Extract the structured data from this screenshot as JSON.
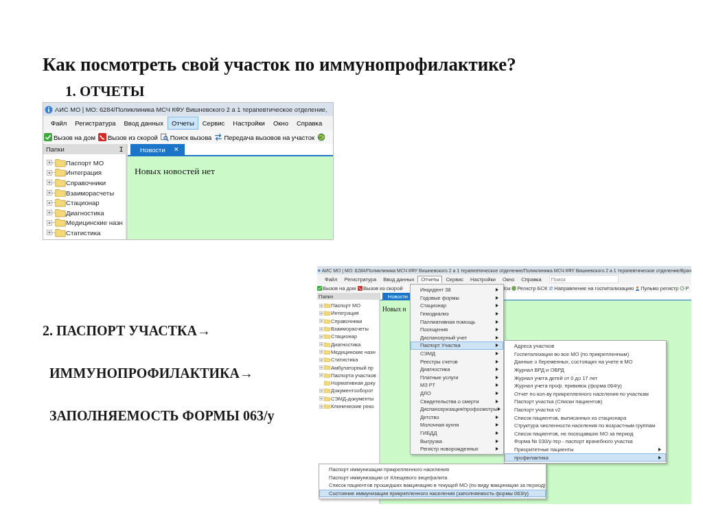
{
  "slide": {
    "title": "Как посмотреть свой участок по иммунопрофилактике?",
    "step_1": "1. ОТЧЕТЫ",
    "step_2_lines": [
      "2.  ПАСПОРТ УЧАСТКА→",
      "ИММУНОПРОФИЛАКТИКА→",
      "ЗАПОЛНЯЕМОСТЬ ФОРМЫ 063/у"
    ]
  },
  "screenshot_1": {
    "window_title": "АИС МО | МО: 6284/Поликлиника МСЧ КФУ Вишневского 2 а 1 терапевтическое отделение,",
    "menu": [
      {
        "label": "Файл",
        "selected": false
      },
      {
        "label": "Регистратура",
        "selected": false
      },
      {
        "label": "Ввод данных",
        "selected": false
      },
      {
        "label": "Отчеты",
        "selected": true
      },
      {
        "label": "Сервис",
        "selected": false
      },
      {
        "label": "Настройки",
        "selected": false
      },
      {
        "label": "Окно",
        "selected": false
      },
      {
        "label": "Справка",
        "selected": false
      }
    ],
    "toolbar": [
      {
        "kind": "check",
        "label": "Вызов на дом"
      },
      {
        "kind": "red",
        "label": "Вызов из скорой"
      },
      {
        "kind": "search",
        "label": "Поиск вызова"
      },
      {
        "kind": "transfer",
        "label": "Передача вызовов на участок"
      },
      {
        "kind": "globe"
      }
    ],
    "panel_title": "Папки",
    "pin": "ⵊ",
    "tree": [
      {
        "label": "Паспорт МО",
        "expandable": true
      },
      {
        "label": "Интеграция",
        "expandable": true
      },
      {
        "label": "Справочники",
        "expandable": true
      },
      {
        "label": "Взаиморасчеты",
        "expandable": true
      },
      {
        "label": "Стационар",
        "expandable": true
      },
      {
        "label": "Диагностика",
        "expandable": true
      },
      {
        "label": "Медицинские назн",
        "expandable": true
      },
      {
        "label": "Статистика",
        "expandable": true
      }
    ],
    "tab": {
      "label": "Новости",
      "close": "✕"
    },
    "content": "Новых новостей нет"
  },
  "screenshot_2": {
    "window_title": "АИС МО | МО: 6284/Поликлиника МСЧ КФУ Вишневского 2 а 1 терапевтическое отделение/Поликлиника МСЧ КФУ Вишневского 2 а 1 терапевтическое отделение/Врач",
    "menu": [
      {
        "label": "Файл",
        "selected": false
      },
      {
        "label": "Регистратура",
        "selected": false
      },
      {
        "label": "Ввод данных",
        "selected": false
      },
      {
        "label": "Отчеты",
        "selected": true
      },
      {
        "label": "Сервис",
        "selected": false
      },
      {
        "label": "Настройки",
        "selected": false
      },
      {
        "label": "Окно",
        "selected": false
      },
      {
        "label": "Справка",
        "selected": false
      }
    ],
    "search": {
      "placeholder": "Поиск"
    },
    "toolbar_left": [
      {
        "kind": "check",
        "label": "Вызов на дом"
      },
      {
        "kind": "red",
        "label": "Вызов из скорой"
      }
    ],
    "toolbar_right": [
      {
        "kind": "none",
        "label": "ток"
      },
      {
        "kind": "globe",
        "label": "Регистр БСК"
      },
      {
        "kind": "transfer",
        "label": "Направление на госпитализацию"
      },
      {
        "kind": "person",
        "label": "Пульмо регистр"
      },
      {
        "kind": "gear",
        "label": "Р"
      }
    ],
    "panel_title": "Папки",
    "tab": {
      "label": "Новости"
    },
    "content": "Новых н",
    "tree": [
      {
        "label": "Паспорт МО",
        "expandable": true
      },
      {
        "label": "Интеграция",
        "expandable": true
      },
      {
        "label": "Справочники",
        "expandable": true
      },
      {
        "label": "Взаиморасчеты",
        "expandable": true
      },
      {
        "label": "Стационар",
        "expandable": true
      },
      {
        "label": "Диагностика",
        "expandable": true
      },
      {
        "label": "Медицинские назн",
        "expandable": true
      },
      {
        "label": "Статистика",
        "expandable": true
      },
      {
        "label": "Амбулаторный пр",
        "expandable": true
      },
      {
        "label": "Паспорта участков",
        "expandable": true
      },
      {
        "label": "Нормативная доку",
        "expandable": false
      },
      {
        "label": "Документооборот",
        "expandable": true
      },
      {
        "label": "СЭМД-документы",
        "expandable": true
      },
      {
        "label": "Клинические реко",
        "expandable": true
      }
    ],
    "reports_menu": [
      {
        "label": "Инцидент 38",
        "selected": false,
        "has_submenu": true
      },
      {
        "label": "Годовые формы",
        "selected": false,
        "has_submenu": true
      },
      {
        "label": "Стационар",
        "selected": false,
        "has_submenu": true
      },
      {
        "label": "Гемодиализ",
        "selected": false,
        "has_submenu": true
      },
      {
        "label": "Паллиативная помощь",
        "selected": false,
        "has_submenu": true
      },
      {
        "label": "Посещения",
        "selected": false,
        "has_submenu": true
      },
      {
        "label": "Диспансерный учет",
        "selected": false,
        "has_submenu": true
      },
      {
        "label": "Паспорт Участка",
        "selected": true,
        "has_submenu": true
      },
      {
        "label": "СЭМД",
        "selected": false,
        "has_submenu": true
      },
      {
        "label": "Реестры счетов",
        "selected": false,
        "has_submenu": true
      },
      {
        "label": "Диагностика",
        "selected": false,
        "has_submenu": true
      },
      {
        "label": "Платные услуги",
        "selected": false,
        "has_submenu": true
      },
      {
        "label": "МЗ РТ",
        "selected": false,
        "has_submenu": true
      },
      {
        "label": "ДЛО",
        "selected": false,
        "has_submenu": true
      },
      {
        "label": "Свидетельства о смерти",
        "selected": false,
        "has_submenu": true
      },
      {
        "label": "Диспансеризация/профосмотры",
        "selected": false,
        "has_submenu": true
      },
      {
        "label": "Детство",
        "selected": false,
        "has_submenu": true
      },
      {
        "label": "Молочная кухня",
        "selected": false,
        "has_submenu": true
      },
      {
        "label": "ГИБДД",
        "selected": false,
        "has_submenu": true
      },
      {
        "label": "Выгрузка",
        "selected": false,
        "has_submenu": true
      },
      {
        "label": "Регистр новорожденных",
        "selected": false,
        "has_submenu": true
      }
    ],
    "district_menu": [
      {
        "label": "Адреса участков",
        "selected": false,
        "has_submenu": false
      },
      {
        "label": "Госпитализации во все МО (по прикрепленным)",
        "selected": false,
        "has_submenu": false
      },
      {
        "label": "Данные о беременных, состоящих на учете в МО",
        "selected": false,
        "has_submenu": false
      },
      {
        "label": "Журнал ВРД и ОВРД",
        "selected": false,
        "has_submenu": false
      },
      {
        "label": "Журнал учета детей от 0 до 17 лет",
        "selected": false,
        "has_submenu": false
      },
      {
        "label": "Журнал учета проф. прививок (форма 064/у)",
        "selected": false,
        "has_submenu": false
      },
      {
        "label": "Отчет по кол-ву прикрепленного населения по участкам",
        "selected": false,
        "has_submenu": false
      },
      {
        "label": "Паспорт участка (Списки пациентов)",
        "selected": false,
        "has_submenu": false
      },
      {
        "label": "Паспорт участка v2",
        "selected": false,
        "has_submenu": false
      },
      {
        "label": "Список пациентов, выписанных из стационара",
        "selected": false,
        "has_submenu": false
      },
      {
        "label": "Структура численности населения по возрастным группам",
        "selected": false,
        "has_submenu": false
      },
      {
        "label": "Список пациентов, не посещавших МО за период",
        "selected": false,
        "has_submenu": false
      },
      {
        "label": "Форма № 030/у-тер - паспорт врачебного участка",
        "selected": false,
        "has_submenu": false
      },
      {
        "label": "Приоритетные пациенты",
        "selected": false,
        "has_submenu": true
      },
      {
        "label": "профилактика",
        "selected": true,
        "has_submenu": true
      }
    ],
    "immuno_menu": [
      {
        "label": "Паспорт иммунизации прикрепленного населения",
        "selected": false
      },
      {
        "label": "Паспорт иммунизации от Клещевого энцефалита",
        "selected": false
      },
      {
        "label": "Список пациентов прошедших вакцинацию в текущей МО (по виду вакцинации за период)",
        "selected": false
      },
      {
        "label": "Состояние иммунизации прикрепленного населения (заполняемость формы 063/у)",
        "selected": true
      }
    ]
  }
}
